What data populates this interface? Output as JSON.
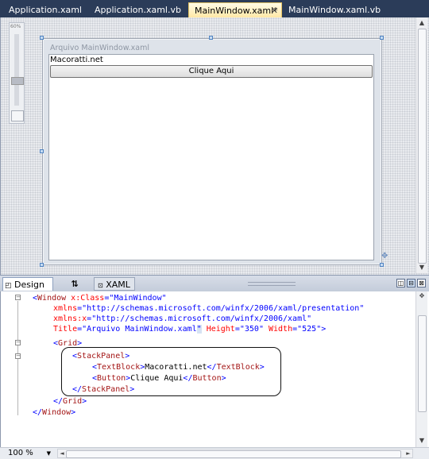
{
  "document_tabs": [
    {
      "label": "Application.xaml",
      "active": false
    },
    {
      "label": "Application.xaml.vb",
      "active": false
    },
    {
      "label": "MainWindow.xaml*",
      "active": true
    },
    {
      "label": "MainWindow.xaml.vb",
      "active": false
    }
  ],
  "tab_close_glyph": "✕",
  "designer": {
    "zoom_rail_label": "60%",
    "window_title": "Arquivo MainWindow.xaml",
    "textblock_text": "Macoratti.net",
    "button_text": "Clique Aqui",
    "scroll_up_glyph": "▲",
    "scroll_down_glyph": "▼"
  },
  "view_tabs": {
    "design_label": "Design",
    "swap_glyph": "⇅",
    "xaml_label": "XAML",
    "pane_buttons": [
      "◫",
      "⊟",
      "⊠"
    ]
  },
  "xaml_code": {
    "line1": {
      "open": "<",
      "elem": "Window",
      "attr": " x:Class",
      "eq": "=",
      "val": "\"MainWindow\""
    },
    "line2": {
      "attr": "xmlns",
      "eq": "=",
      "val": "\"http://schemas.microsoft.com/winfx/2006/xaml/presentation\""
    },
    "line3": {
      "attr": "xmlns:x",
      "eq": "=",
      "val": "\"http://schemas.microsoft.com/winfx/2006/xaml\""
    },
    "line4": {
      "attr1": "Title",
      "eq": "=",
      "val1_a": "\"Arquivo MainWindow.xaml",
      "val1_b": "\"",
      "attr2": " Height",
      "val2": "\"350\"",
      "attr3": " Width",
      "val3": "\"525\"",
      "close": ">"
    },
    "line5": {
      "open": "<",
      "elem": "Grid",
      "close": ">"
    },
    "line6": {
      "open": "<",
      "elem": "StackPanel",
      "close": ">"
    },
    "line7": {
      "open": "<",
      "elem": "TextBlock",
      "close": ">",
      "text": "Macoratti.net",
      "end_open": "</",
      "end_elem": "TextBlock",
      "end_close": ">"
    },
    "line8": {
      "open": "<",
      "elem": "Button",
      "close": ">",
      "text": "Clique Aqui",
      "end_open": "</",
      "end_elem": "Button",
      "end_close": ">"
    },
    "line9": {
      "open": "</",
      "elem": "StackPanel",
      "close": ">"
    },
    "line10": {
      "open": "</",
      "elem": "Grid",
      "close": ">"
    },
    "line11": {
      "open": "</",
      "elem": "Window",
      "close": ">"
    }
  },
  "fold_markers": [
    "−",
    "−",
    "−"
  ],
  "status": {
    "zoom_value": "100 %",
    "zoom_dropdown_glyph": "▼",
    "hscroll_left_glyph": "◄",
    "hscroll_right_glyph": "►"
  }
}
